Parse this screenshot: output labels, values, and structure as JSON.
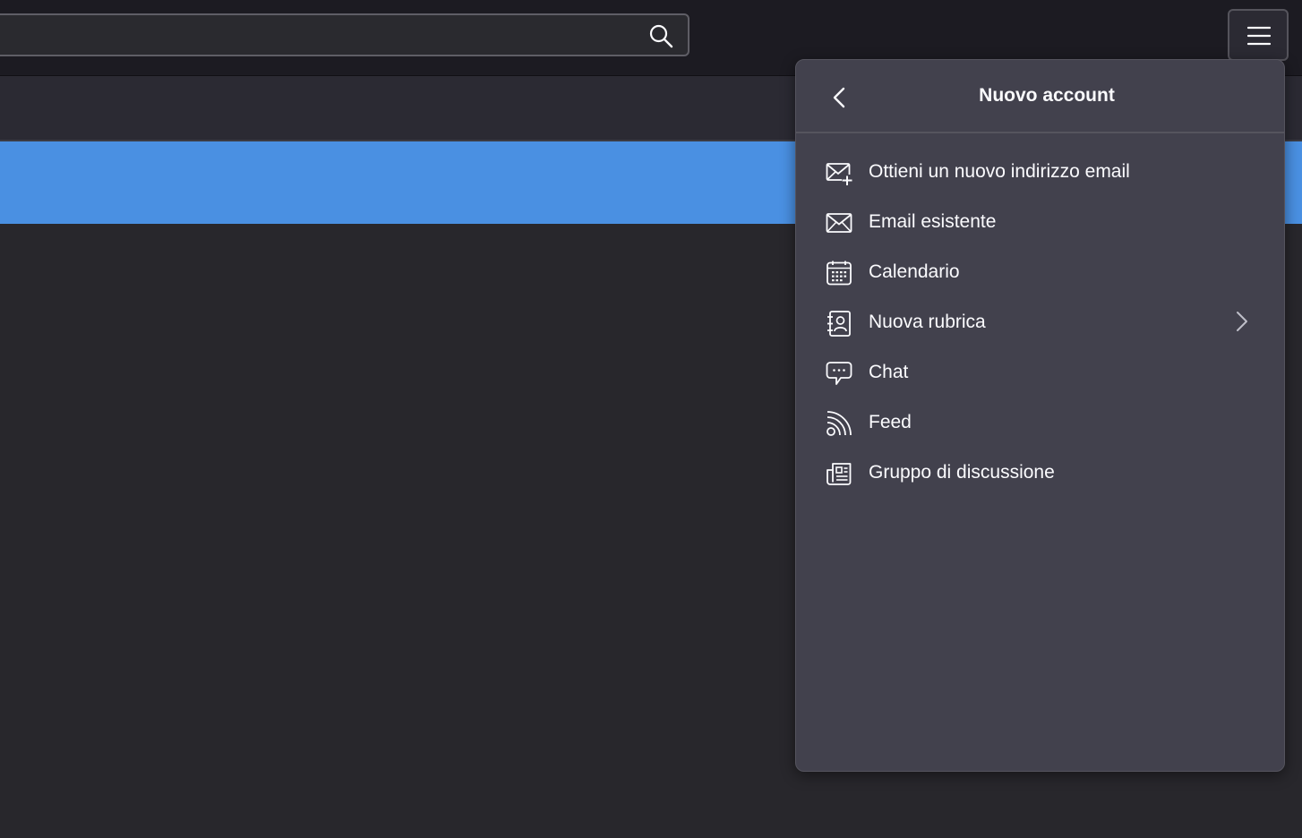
{
  "search": {
    "value": "",
    "placeholder": ""
  },
  "toolbar": {
    "search_icon": "search-icon",
    "menu_icon": "hamburger-menu-icon"
  },
  "panel": {
    "title": "Nuovo account",
    "back_icon": "chevron-left-icon",
    "items": [
      {
        "label": "Ottieni un nuovo indirizzo email",
        "icon": "mail-plus-icon",
        "has_submenu": false
      },
      {
        "label": "Email esistente",
        "icon": "mail-icon",
        "has_submenu": false
      },
      {
        "label": "Calendario",
        "icon": "calendar-icon",
        "has_submenu": false
      },
      {
        "label": "Nuova rubrica",
        "icon": "address-book-icon",
        "has_submenu": true
      },
      {
        "label": "Chat",
        "icon": "chat-icon",
        "has_submenu": false
      },
      {
        "label": "Feed",
        "icon": "rss-feed-icon",
        "has_submenu": false
      },
      {
        "label": "Gruppo di discussione",
        "icon": "newsgroup-icon",
        "has_submenu": false
      }
    ]
  },
  "colors": {
    "toolbar_bg": "#1c1b22",
    "panel_bg": "#42414d",
    "selection": "#4a90e2",
    "text": "#fbfbfe"
  }
}
